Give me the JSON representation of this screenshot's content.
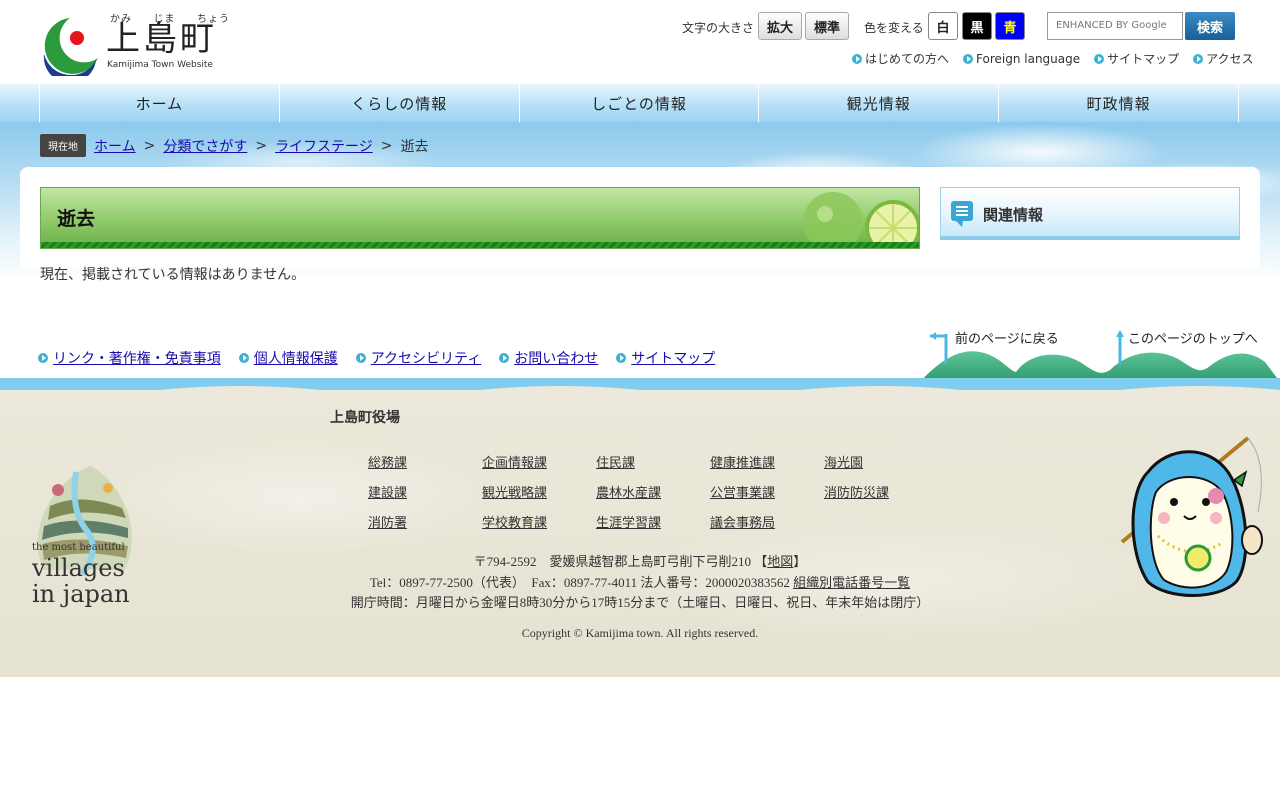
{
  "header": {
    "logo_ruby": [
      "かみ",
      "じま",
      "ちょう"
    ],
    "logo_title": "上島町",
    "logo_subtitle": "Kamijima Town Website",
    "text_size_label": "文字の大きさ",
    "text_size_buttons": [
      "拡大",
      "標準"
    ],
    "color_label": "色を変える",
    "color_buttons": [
      {
        "label": "白",
        "bg": "#ffffff",
        "fg": "#222222"
      },
      {
        "label": "黒",
        "bg": "#000000",
        "fg": "#ffffff"
      },
      {
        "label": "青",
        "bg": "#0000ff",
        "fg": "#ffff00"
      }
    ],
    "search_placeholder": "ENHANCED BY Google",
    "search_button": "検索",
    "top_links": [
      "はじめての方へ",
      "Foreign language",
      "サイトマップ",
      "アクセス"
    ]
  },
  "nav": {
    "items": [
      "ホーム",
      "くらしの情報",
      "しごとの情報",
      "観光情報",
      "町政情報"
    ]
  },
  "breadcrumb": {
    "badge": "現在地",
    "items": [
      "ホーム",
      "分類でさがす",
      "ライフステージ"
    ],
    "separator": ">",
    "current": "逝去"
  },
  "main": {
    "title": "逝去",
    "message": "現在、掲載されている情報はありません。"
  },
  "sidebar": {
    "title": "関連情報"
  },
  "footer_links": [
    "リンク・著作権・免責事項",
    "個人情報保護",
    "アクセシビリティ",
    "お問い合わせ",
    "サイトマップ"
  ],
  "page_nav": {
    "back": "前のページに戻る",
    "top": "このページのトップへ"
  },
  "footer": {
    "office_name": "上島町役場",
    "departments": [
      [
        "総務課",
        "企画情報課",
        "住民課",
        "健康推進課",
        "海光園"
      ],
      [
        "建設課",
        "観光戦略課",
        "農林水産課",
        "公営事業課",
        "消防防災課"
      ],
      [
        "消防署",
        "学校教育課",
        "生涯学習課",
        "議会事務局"
      ]
    ],
    "address": "〒794-2592　愛媛県越智郡上島町弓削下弓削210",
    "map_link": "地図",
    "map_open": "【",
    "map_close": "】",
    "tel_fax": "Tel：0897-77-2500（代表）　Fax：0897-77-4011 法人番号：2000020383562",
    "phone_list_link": "組織別電話番号一覧",
    "hours": "開庁時間：月曜日から金曜日8時30分から17時15分まで（土曜日、日曜日、祝日、年末年始は閉庁）",
    "copyright": "Copyright © Kamijima town. All rights reserved.",
    "villages_text": [
      "the most beautiful",
      "villages",
      "in japan"
    ]
  },
  "colors": {
    "nav_bg": "#b7e1f7",
    "title_green": "#8fc968",
    "link": "#1a0dab",
    "footer_bg": "#e9e6d8"
  }
}
